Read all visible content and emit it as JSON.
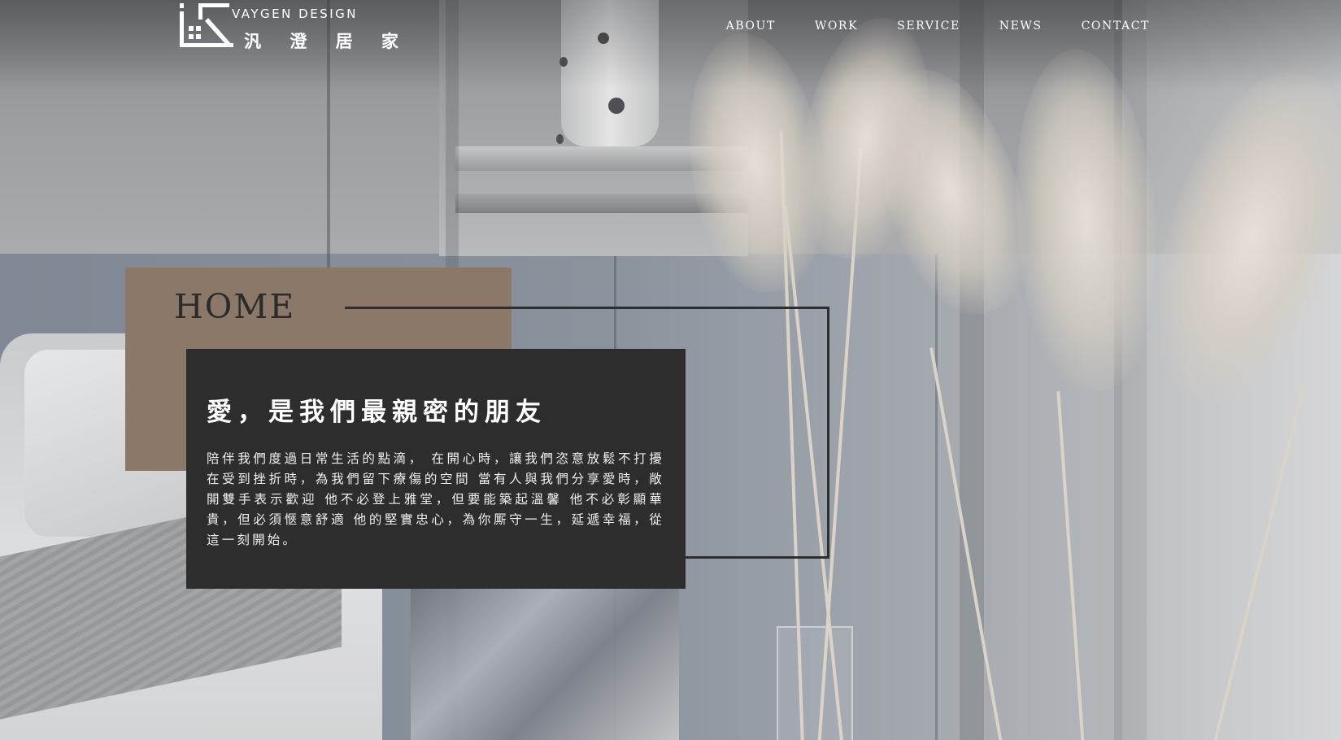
{
  "brand": {
    "name_en": "VAYGEN DESIGN",
    "name_zh": "汎 澄 居 家",
    "logo_icon": "vaygen-logo-mark"
  },
  "nav": {
    "items": [
      {
        "label": "ABOUT"
      },
      {
        "label": "WORK"
      },
      {
        "label": "SERVICE"
      },
      {
        "label": "NEWS"
      },
      {
        "label": "CONTACT"
      }
    ]
  },
  "hero": {
    "section_label": "HOME",
    "heading": "愛，是我們最親密的朋友",
    "body": "陪伴我們度過日常生活的點滴， 在開心時，讓我們恣意放鬆不打擾 在受到挫折時，為我們留下療傷的空間 當有人與我們分享愛時，敞開雙手表示歡迎 他不必登上雅堂，但要能築起溫馨 他不必彰顯華貴，但必須愜意舒適 他的堅實忠心，為你厮守一生，延遞幸福，從這一刻開始。"
  },
  "colors": {
    "accent_tan": "#8c7868",
    "card_dark": "#2d2d2e",
    "text_light": "#ffffff",
    "title_dark": "#2b2b2c"
  }
}
